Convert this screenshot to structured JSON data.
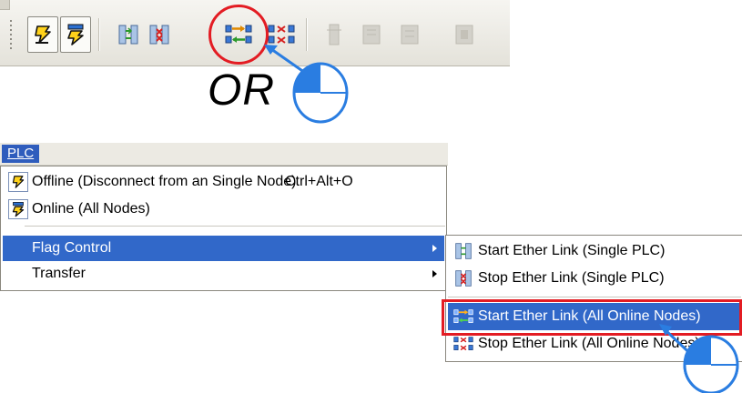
{
  "toolbar": {
    "buttons": [
      {
        "icon": "offline-plug-icon"
      },
      {
        "icon": "online-all-nodes-icon"
      },
      {
        "icon": "start-ether-link-single-icon"
      },
      {
        "icon": "stop-ether-link-single-icon"
      },
      {
        "icon": "start-ether-link-all-icon"
      },
      {
        "icon": "stop-ether-link-all-icon"
      },
      {
        "icon": "disabled-icon"
      },
      {
        "icon": "disabled-icon"
      },
      {
        "icon": "disabled-icon"
      },
      {
        "icon": "disabled-icon"
      }
    ]
  },
  "or_label": "OR",
  "menubar": {
    "title": "PLC"
  },
  "menu": {
    "items": [
      {
        "label": "Offline (Disconnect from an Single Node)",
        "shortcut": "Ctrl+Alt+O",
        "icon": "offline-plug-icon"
      },
      {
        "label": "Online (All Nodes)",
        "shortcut": "",
        "icon": "online-all-nodes-icon"
      },
      {
        "label": "Flag Control",
        "submenu": true,
        "active": true
      },
      {
        "label": "Transfer",
        "submenu": true
      }
    ]
  },
  "submenu": {
    "items": [
      {
        "label": "Start Ether Link (Single PLC)",
        "icon": "start-ether-link-single-icon"
      },
      {
        "label": "Stop Ether Link (Single PLC)",
        "icon": "stop-ether-link-single-icon"
      },
      {
        "label": "Start Ether Link (All Online Nodes)",
        "icon": "start-ether-link-all-icon",
        "active": true
      },
      {
        "label": "Stop Ether Link (All Online Nodes)",
        "icon": "stop-ether-link-all-icon"
      }
    ]
  },
  "colors": {
    "highlight": "#e31c23",
    "selection": "#3168c9",
    "pointer": "#2a7de1"
  }
}
